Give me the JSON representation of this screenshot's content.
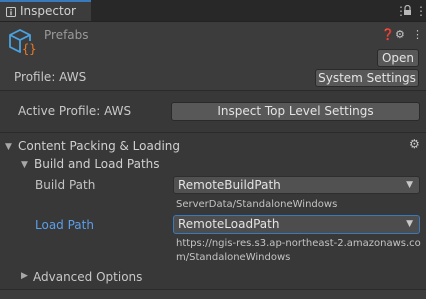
{
  "tab": {
    "title": "Inspector"
  },
  "toolbar": {
    "lock_icon": "lock-icon",
    "menu_icon": "kebab-menu-icon"
  },
  "header": {
    "asset_name": "Prefabs",
    "open_label": "Open",
    "profile_text": "Profile: AWS",
    "system_settings_label": "System Settings"
  },
  "main": {
    "active_profile_text": "Active Profile: AWS",
    "inspect_button_label": "Inspect Top Level Settings",
    "section_title": "Content Packing & Loading",
    "subsection_title": "Build and Load Paths",
    "build_path_label": "Build Path",
    "build_path_value": "RemoteBuildPath",
    "build_path_resolved": "ServerData/StandaloneWindows",
    "load_path_label": "Load Path",
    "load_path_value": "RemoteLoadPath",
    "load_path_resolved_1": "https://ngis-res.s3.ap-northeast-2.amazonaws.co",
    "load_path_resolved_2": "m/StandaloneWindows",
    "advanced_label": "Advanced Options"
  },
  "colors": {
    "accent": "#3a79bb",
    "link_label": "#5c9ee8",
    "background": "#383838"
  }
}
